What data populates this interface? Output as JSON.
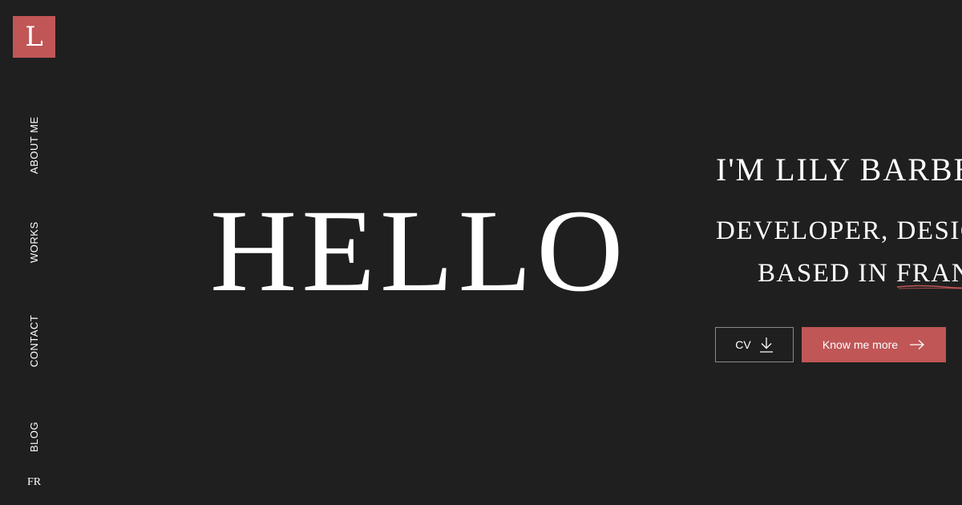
{
  "logo": {
    "letter": "L",
    "color": "#c05656"
  },
  "side_nav": {
    "items": [
      {
        "label": "ABOUT ME"
      },
      {
        "label": "WORKS"
      },
      {
        "label": "CONTACT"
      },
      {
        "label": "BLOG"
      }
    ],
    "language": "FR"
  },
  "hero": {
    "greeting": "HELLO",
    "intro": "I'M LILY BARBERO",
    "role_line1": "DEVELOPER, DESIGNER",
    "role_line2_prefix": "BASED IN ",
    "role_country": "FRANCE"
  },
  "buttons": {
    "cv_label": "CV",
    "cv_icon": "download-icon",
    "more_label": "Know me more",
    "more_icon": "arrow-right-icon"
  },
  "colors": {
    "background": "#1f1f1f",
    "accent": "#c05656",
    "text": "#ffffff"
  }
}
